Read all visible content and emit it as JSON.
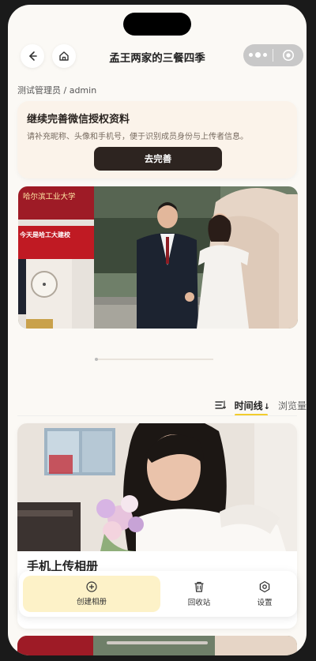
{
  "nav": {
    "title": "孟王两家的三餐四季",
    "back_icon": "chevron-left-icon",
    "home_icon": "home-icon",
    "more_icon": "more-dots-icon",
    "close_icon": "target-icon"
  },
  "user": {
    "line": "测试管理员 / admin"
  },
  "auth_card": {
    "title": "继续完善微信授权资料",
    "desc": "请补充昵称、头像和手机号，便于识别成员身份与上传者信息。",
    "button": "去完善"
  },
  "banner": {
    "sign_line1": "哈尔滨工业大学",
    "sign_line2": "今天是哈工大建校"
  },
  "sort": {
    "icon": "sort-icon",
    "active_tab": "时间线",
    "active_arrow": "↓",
    "other_tab": "浏览量"
  },
  "album": {
    "title": "手机上传相册"
  },
  "tabbar": {
    "items": [
      {
        "label": "创建相册",
        "icon": "plus-circle-icon"
      },
      {
        "label": "回收站",
        "icon": "trash-icon"
      },
      {
        "label": "设置",
        "icon": "gear-icon"
      }
    ]
  },
  "colors": {
    "accent": "#f2cc2c",
    "dark_button": "#2d2420",
    "page_bg": "#fbf9f5"
  }
}
